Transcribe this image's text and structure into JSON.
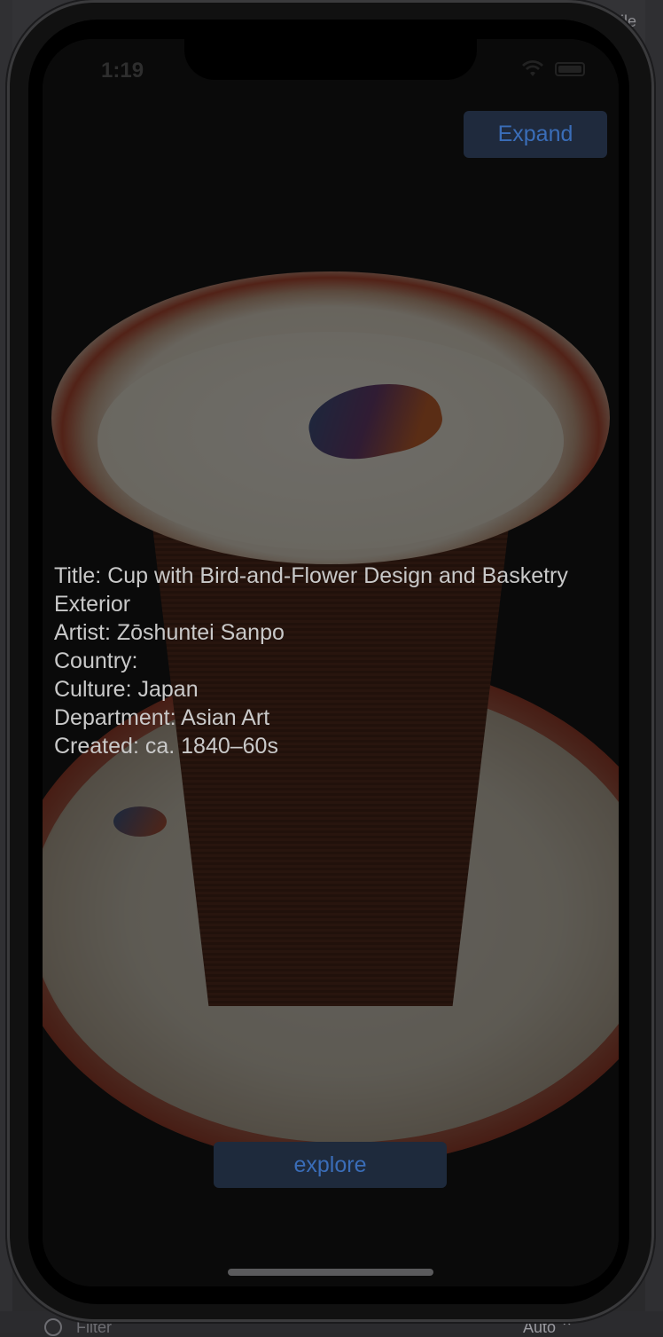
{
  "ide": {
    "filter_placeholder": "Filter",
    "auto_label": "Auto ⌃",
    "top_right_text": "bile"
  },
  "status_bar": {
    "time": "1:19"
  },
  "toolbar": {
    "expand_label": "Expand"
  },
  "artwork": {
    "title_label": "Title:",
    "title": "Cup with Bird-and-Flower Design and Basketry Exterior",
    "artist_label": "Artist:",
    "artist": "Zōshuntei Sanpo",
    "country_label": "Country:",
    "country": "",
    "culture_label": "Culture:",
    "culture": "Japan",
    "department_label": "Department:",
    "department": "Asian Art",
    "created_label": "Created:",
    "created": "ca. 1840–60s"
  },
  "actions": {
    "explore_label": "explore"
  },
  "icons": {
    "wifi": "wifi-icon",
    "battery": "battery-icon",
    "filter": "filter-icon"
  },
  "colors": {
    "button_text": "#3a6db8",
    "button_bg": "#1f2a3d",
    "info_text": "#c9c9c9"
  }
}
